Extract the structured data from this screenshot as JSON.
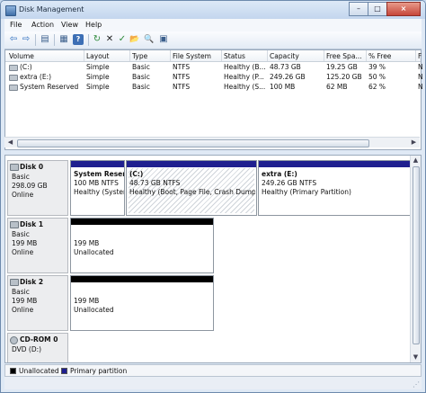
{
  "window": {
    "title": "Disk Management",
    "minimize": "–",
    "maximize": "□",
    "close": "×"
  },
  "menu": [
    "File",
    "Action",
    "View",
    "Help"
  ],
  "toolbar": {
    "icons": [
      "back-icon",
      "forward-icon",
      "separator",
      "up-pane-icon",
      "separator",
      "properties-icon",
      "help-icon",
      "separator",
      "refresh-icon",
      "delete-icon",
      "check-icon",
      "open-icon",
      "search-disk-icon",
      "settings-icon"
    ],
    "glyphs": [
      "⇦",
      "⇨",
      "",
      "▤",
      "",
      "▦",
      "?",
      "",
      "↻",
      "✕",
      "✓",
      "📂",
      "🔍",
      "▣"
    ]
  },
  "volume_list": {
    "columns": [
      "Volume",
      "Layout",
      "Type",
      "File System",
      "Status",
      "Capacity",
      "Free Spa...",
      "% Free",
      "F"
    ],
    "rows": [
      {
        "volume": "(C:)",
        "layout": "Simple",
        "type": "Basic",
        "fs": "NTFS",
        "status": "Healthy (B...",
        "capacity": "48.73 GB",
        "free": "19.25 GB",
        "pct": "39 %",
        "f": "N"
      },
      {
        "volume": "extra (E:)",
        "layout": "Simple",
        "type": "Basic",
        "fs": "NTFS",
        "status": "Healthy (P...",
        "capacity": "249.26 GB",
        "free": "125.20 GB",
        "pct": "50 %",
        "f": "N"
      },
      {
        "volume": "System Reserved",
        "layout": "Simple",
        "type": "Basic",
        "fs": "NTFS",
        "status": "Healthy (S...",
        "capacity": "100 MB",
        "free": "62 MB",
        "pct": "62 %",
        "f": "N"
      }
    ]
  },
  "disks": [
    {
      "name": "Disk 0",
      "type": "Basic",
      "size": "298.09 GB",
      "state": "Online",
      "partitions": [
        {
          "title": "System Reser",
          "size": "100 MB NTFS",
          "status": "Healthy (Syster",
          "kind": "primary"
        },
        {
          "title": "(C:)",
          "size": "48.73 GB NTFS",
          "status": "Healthy (Boot, Page File, Crash Dump, P",
          "kind": "primary-selected"
        },
        {
          "title": "extra  (E:)",
          "size": "249.26 GB NTFS",
          "status": "Healthy (Primary Partition)",
          "kind": "primary"
        }
      ]
    },
    {
      "name": "Disk 1",
      "type": "Basic",
      "size": "199 MB",
      "state": "Online",
      "partitions": [
        {
          "size": "199 MB",
          "status": "Unallocated",
          "kind": "unallocated"
        }
      ]
    },
    {
      "name": "Disk 2",
      "type": "Basic",
      "size": "199 MB",
      "state": "Online",
      "partitions": [
        {
          "size": "199 MB",
          "status": "Unallocated",
          "kind": "unallocated"
        }
      ]
    },
    {
      "name": "CD-ROM 0",
      "type": "DVD (D:)"
    }
  ],
  "legend": {
    "unallocated": "Unallocated",
    "primary": "Primary partition"
  },
  "colors": {
    "primary": "#1f1f8f",
    "unallocated": "#000000",
    "hatch": "#cfd4da"
  }
}
